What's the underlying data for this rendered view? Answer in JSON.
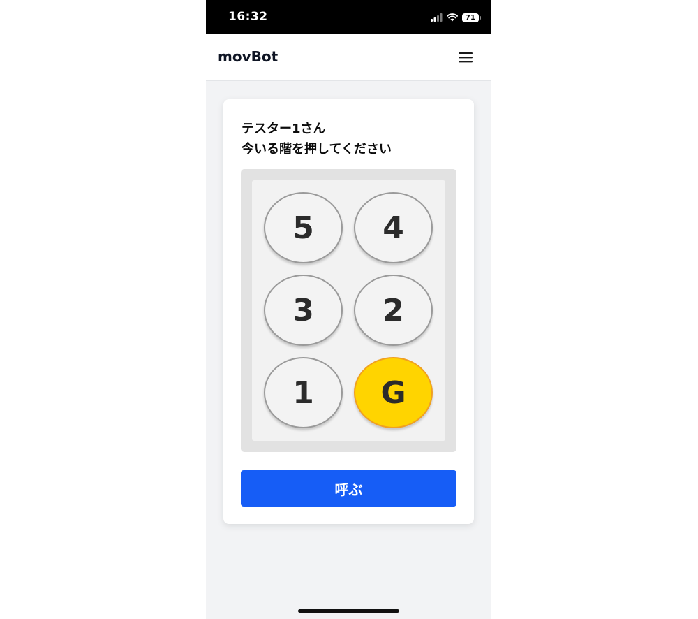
{
  "status_bar": {
    "time": "16:32",
    "battery": "71",
    "icons": [
      "signal-icon",
      "wifi-icon",
      "battery-icon"
    ]
  },
  "header": {
    "title": "movBot",
    "menu_icon": "menu-icon"
  },
  "card": {
    "greeting": "テスター1さん",
    "instruction": "今いる階を押してください",
    "floors": [
      {
        "label": "5",
        "selected": false
      },
      {
        "label": "4",
        "selected": false
      },
      {
        "label": "3",
        "selected": false
      },
      {
        "label": "2",
        "selected": false
      },
      {
        "label": "1",
        "selected": false
      },
      {
        "label": "G",
        "selected": true
      }
    ],
    "call_button_label": "呼ぶ"
  },
  "colors": {
    "accent_blue": "#165df6",
    "selected_yellow": "#ffd400",
    "selected_border": "#f0a020",
    "page_background": "#f2f3f5"
  }
}
